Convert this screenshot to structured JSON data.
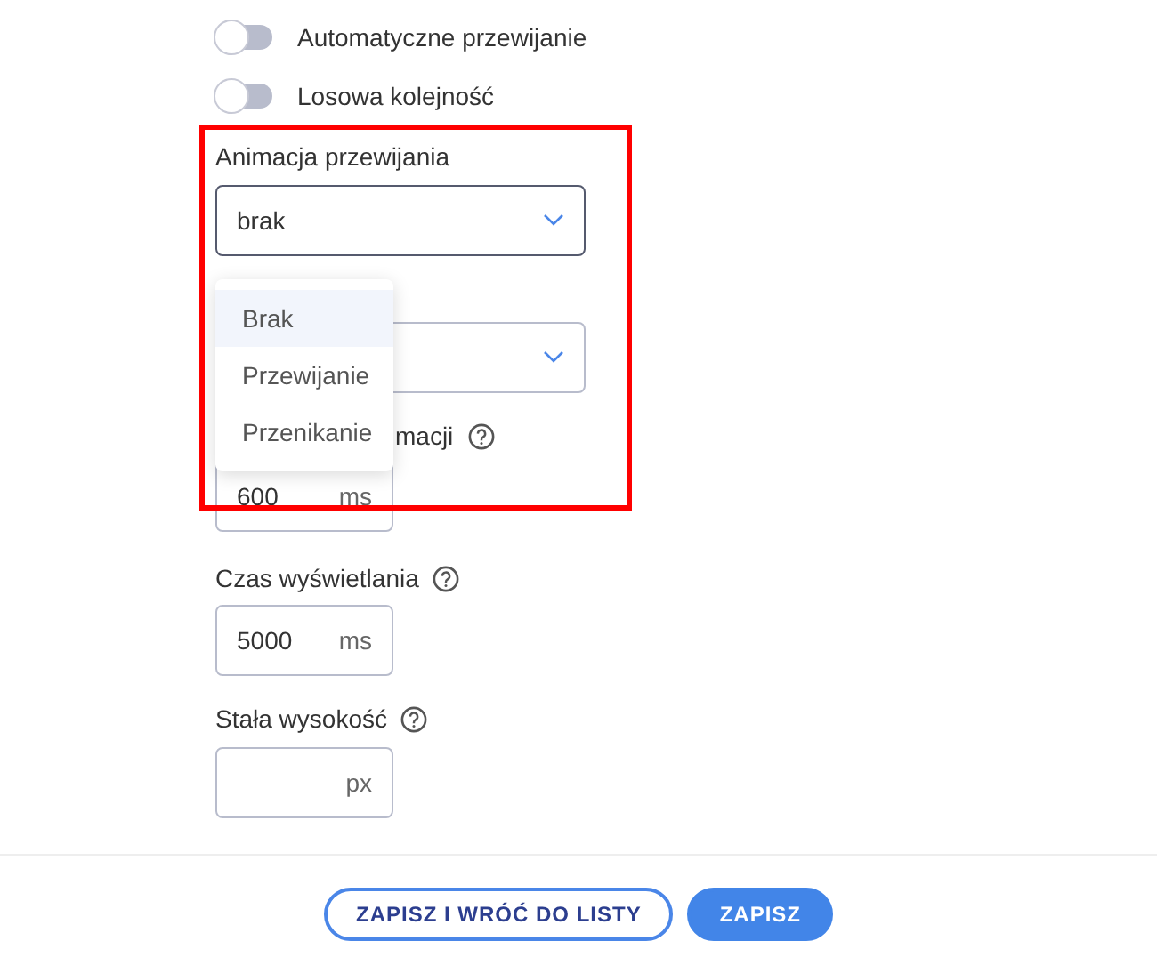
{
  "toggles": [
    {
      "label": "Automatyczne przewijanie",
      "on": false
    },
    {
      "label": "Losowa kolejność",
      "on": false
    }
  ],
  "animation_select": {
    "label": "Animacja przewijania",
    "value": "brak",
    "expanded": true,
    "options": [
      {
        "label": "Brak",
        "selected": true
      },
      {
        "label": "Przewijanie",
        "selected": false
      },
      {
        "label": "Przenikanie",
        "selected": false
      }
    ]
  },
  "animation_duration": {
    "label": "macji",
    "value": "600",
    "unit": "ms"
  },
  "display_time": {
    "label": "Czas wyświetlania",
    "value": "5000",
    "unit": "ms"
  },
  "fixed_height": {
    "label": "Stała wysokość",
    "unit": "px"
  },
  "buttons": [
    {
      "label": "ZAPISZ I WRÓĆ DO LISTY",
      "kind": "outline"
    },
    {
      "label": "ZAPISZ",
      "kind": "primary"
    }
  ]
}
